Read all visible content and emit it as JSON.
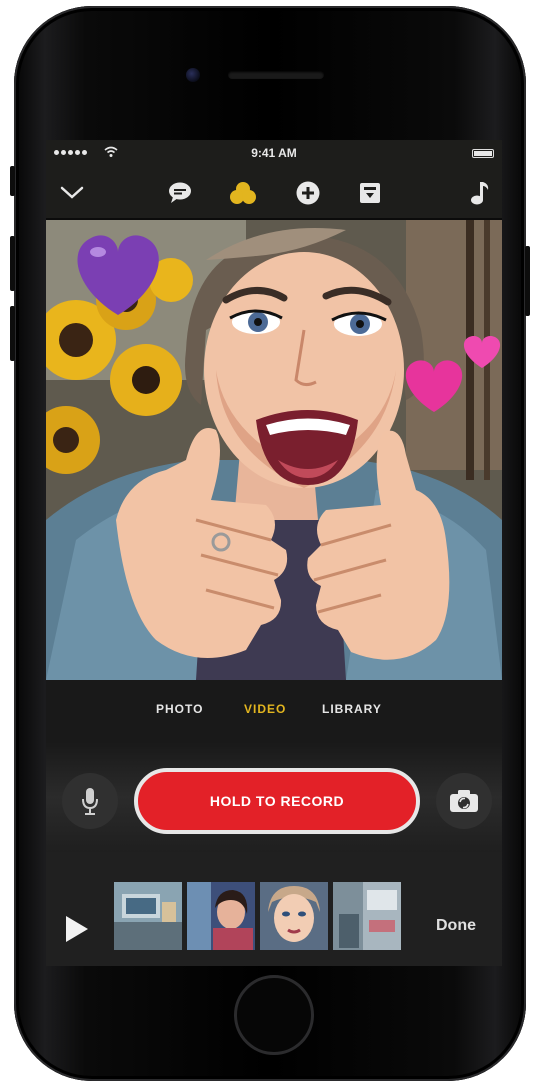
{
  "status_bar": {
    "time": "9:41 AM"
  },
  "toolbar": {
    "icons": [
      "chevron-down-icon",
      "speech-bubble-icon",
      "filter-circles-icon",
      "sticker-plus-icon",
      "title-card-icon",
      "music-note-icon"
    ],
    "active_icon": "filter-circles-icon",
    "accent_color": "#e2b51f"
  },
  "modes": {
    "photo": "PHOTO",
    "video": "VIDEO",
    "library": "LIBRARY",
    "active": "video"
  },
  "record": {
    "label": "HOLD TO RECORD",
    "color": "#e32128"
  },
  "timeline": {
    "done_label": "Done",
    "clip_count": 4
  }
}
